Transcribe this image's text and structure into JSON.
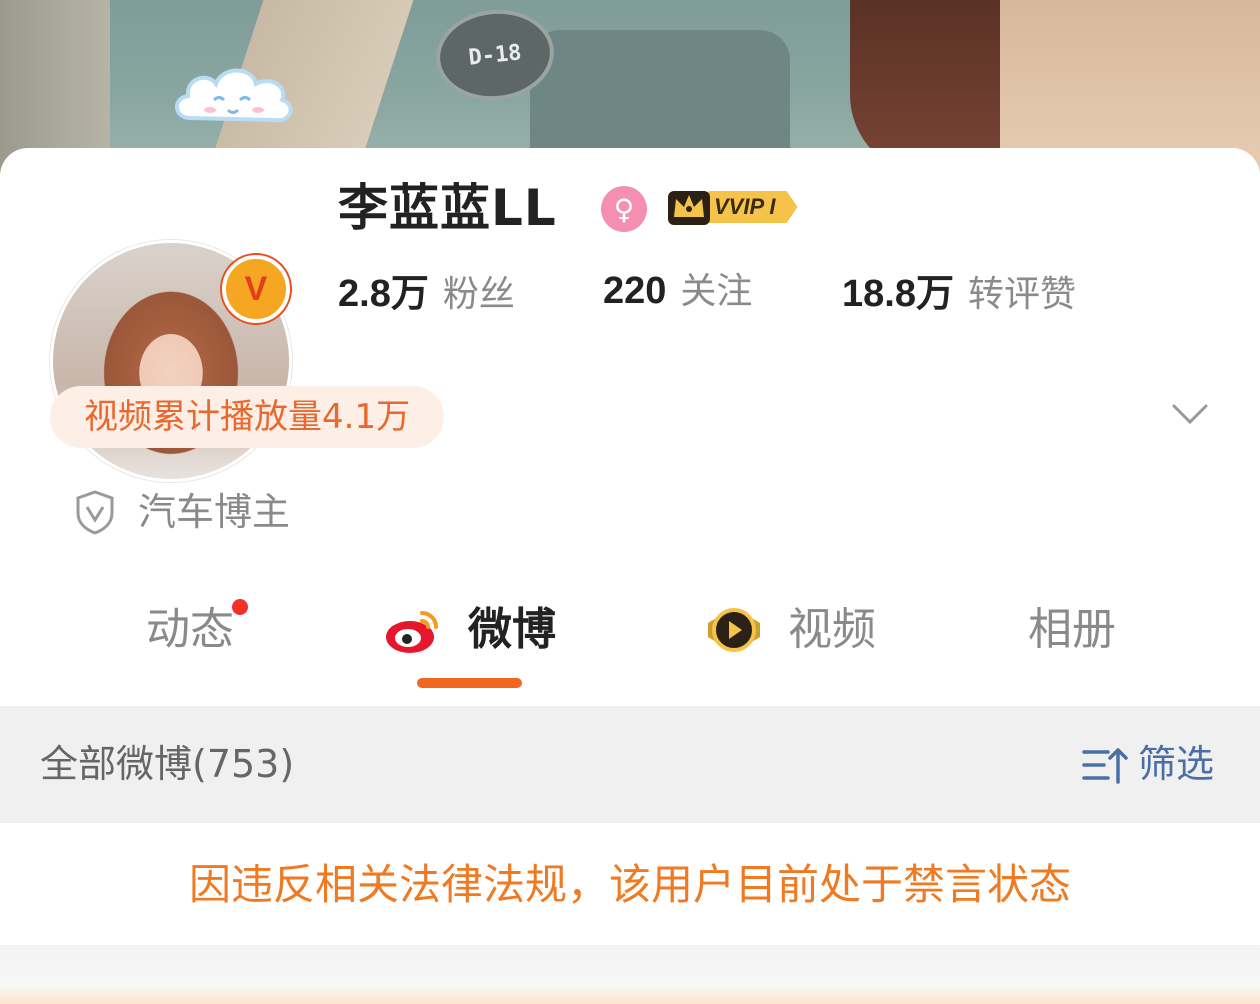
{
  "banner": {
    "sticker_text": "D-18"
  },
  "profile": {
    "name": "李蓝蓝LL",
    "gender_symbol": "♀",
    "verified_badge": "V",
    "vip_label": "VVIP I",
    "stats": [
      {
        "num": "2.8万",
        "label": "粉丝"
      },
      {
        "num": "220",
        "label": "关注"
      },
      {
        "num": "18.8万",
        "label": "转评赞"
      }
    ],
    "video_plays": "视频累计播放量4.1万",
    "tagline": "汽车博主"
  },
  "tabs": [
    {
      "label": "动态",
      "has_dot": true
    },
    {
      "label": "微博",
      "active": true
    },
    {
      "label": "视频"
    },
    {
      "label": "相册"
    }
  ],
  "filterbar": {
    "count_label": "全部微博(753)",
    "filter_label": "筛选"
  },
  "notice": "因违反相关法律法规，该用户目前处于禁言状态",
  "colors": {
    "accent": "#f2671f",
    "notice": "#f07a22",
    "filter": "#4a6fa5",
    "pill_bg": "#fdeee6"
  }
}
